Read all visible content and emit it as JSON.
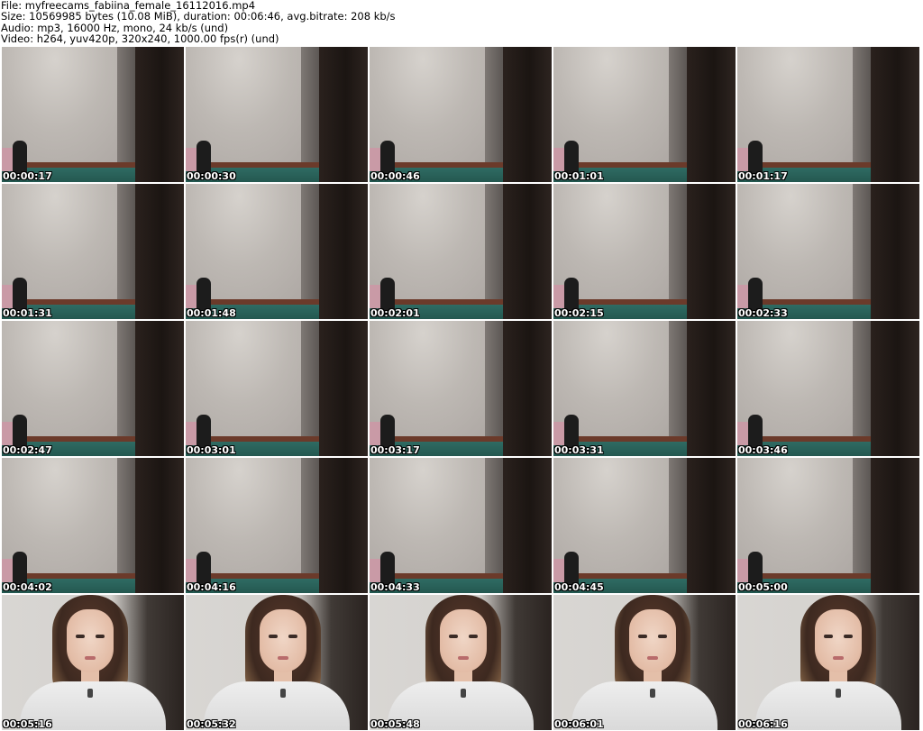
{
  "header": {
    "file_line": "File: myfreecams_fabiina_female_16112016.mp4",
    "size_line": "Size: 10569985 bytes (10.08 MiB), duration: 00:06:46, avg.bitrate: 208 kb/s",
    "audio_line": "Audio: mp3, 16000 Hz, mono, 24 kb/s (und)",
    "video_line": "Video: h264, yuv420p, 320x240, 1000.00 fps(r) (und)"
  },
  "thumbnails": [
    {
      "time": "00:00:17",
      "scene": "room"
    },
    {
      "time": "00:00:30",
      "scene": "room"
    },
    {
      "time": "00:00:46",
      "scene": "room"
    },
    {
      "time": "00:01:01",
      "scene": "room"
    },
    {
      "time": "00:01:17",
      "scene": "room"
    },
    {
      "time": "00:01:31",
      "scene": "room"
    },
    {
      "time": "00:01:48",
      "scene": "room"
    },
    {
      "time": "00:02:01",
      "scene": "room"
    },
    {
      "time": "00:02:15",
      "scene": "room"
    },
    {
      "time": "00:02:33",
      "scene": "room"
    },
    {
      "time": "00:02:47",
      "scene": "room"
    },
    {
      "time": "00:03:01",
      "scene": "room"
    },
    {
      "time": "00:03:17",
      "scene": "room"
    },
    {
      "time": "00:03:31",
      "scene": "room"
    },
    {
      "time": "00:03:46",
      "scene": "room"
    },
    {
      "time": "00:04:02",
      "scene": "room"
    },
    {
      "time": "00:04:16",
      "scene": "room"
    },
    {
      "time": "00:04:33",
      "scene": "room"
    },
    {
      "time": "00:04:45",
      "scene": "room"
    },
    {
      "time": "00:05:00",
      "scene": "room"
    },
    {
      "time": "00:05:16",
      "scene": "person"
    },
    {
      "time": "00:05:32",
      "scene": "person"
    },
    {
      "time": "00:05:48",
      "scene": "person"
    },
    {
      "time": "00:06:01",
      "scene": "person"
    },
    {
      "time": "00:06:16",
      "scene": "person"
    }
  ]
}
